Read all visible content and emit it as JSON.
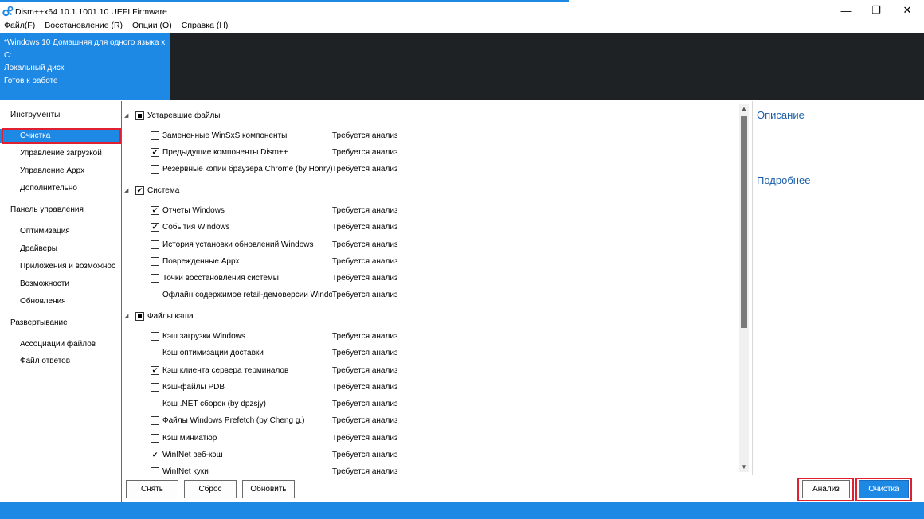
{
  "window": {
    "title": "Dism++x64 10.1.1001.10 UEFI Firmware",
    "minimize": "—",
    "maximize": "❐",
    "close": "✕"
  },
  "menu": [
    "Файл(F)",
    "Восстановление (R)",
    "Опции (O)",
    "Справка (H)"
  ],
  "session": {
    "os": "*Windows 10 Домашняя для одного языка x",
    "drive": "C:",
    "disk": "Локальный диск",
    "status": "Готов к работе"
  },
  "sidebar": {
    "groups": [
      {
        "label": "Инструменты",
        "items": [
          "Очистка",
          "Управление загрузкой",
          "Управление Appx",
          "Дополнительно"
        ]
      },
      {
        "label": "Панель управления",
        "items": [
          "Оптимизация",
          "Драйверы",
          "Приложения и возможнос",
          "Возможности",
          "Обновления"
        ]
      },
      {
        "label": "Развертывание",
        "items": [
          "Ассоциации файлов",
          "Файл ответов"
        ]
      }
    ]
  },
  "cleanup": {
    "categories": [
      {
        "label": "Устаревшие файлы",
        "state": "partial",
        "items": [
          {
            "label": "Замененные WinSxS компоненты",
            "checked": false,
            "status": "Требуется анализ"
          },
          {
            "label": "Предыдущие компоненты Dism++",
            "checked": true,
            "status": "Требуется анализ"
          },
          {
            "label": "Резервные копии браузера Chrome (by Honry)",
            "checked": false,
            "status": "Требуется анализ"
          }
        ]
      },
      {
        "label": "Система",
        "state": "checked",
        "items": [
          {
            "label": "Отчеты Windows",
            "checked": true,
            "status": "Требуется анализ"
          },
          {
            "label": "События Windows",
            "checked": true,
            "status": "Требуется анализ"
          },
          {
            "label": "История установки обновлений Windows",
            "checked": false,
            "status": "Требуется анализ"
          },
          {
            "label": "Поврежденные Appx",
            "checked": false,
            "status": "Требуется анализ"
          },
          {
            "label": "Точки восстановления системы",
            "checked": false,
            "status": "Требуется анализ"
          },
          {
            "label": "Офлайн содержимое retail-демоверсии Windows",
            "checked": false,
            "status": "Требуется анализ"
          }
        ]
      },
      {
        "label": "Файлы кэша",
        "state": "partial",
        "items": [
          {
            "label": "Кэш загрузки Windows",
            "checked": false,
            "status": "Требуется анализ"
          },
          {
            "label": "Кэш оптимизации доставки",
            "checked": false,
            "status": "Требуется анализ"
          },
          {
            "label": "Кэш клиента сервера терминалов",
            "checked": true,
            "status": "Требуется анализ"
          },
          {
            "label": "Кэш-файлы PDB",
            "checked": false,
            "status": "Требуется анализ"
          },
          {
            "label": "Кэш .NET сборок (by dpzsjy)",
            "checked": false,
            "status": "Требуется анализ"
          },
          {
            "label": "Файлы Windows Prefetch (by Cheng g.)",
            "checked": false,
            "status": "Требуется анализ"
          },
          {
            "label": "Кэш миниатюр",
            "checked": false,
            "status": "Требуется анализ"
          },
          {
            "label": "WinINet веб-кэш",
            "checked": true,
            "status": "Требуется анализ"
          },
          {
            "label": "WinINet куки",
            "checked": false,
            "status": "Требуется анализ"
          }
        ]
      }
    ]
  },
  "description": {
    "title": "Описание",
    "details": "Подробнее"
  },
  "buttons": {
    "uncheck": "Снять",
    "reset": "Сброс",
    "refresh": "Обновить",
    "analyze": "Анализ",
    "clean": "Очистка"
  },
  "colors": {
    "accent": "#1e88e5",
    "highlight": "#e02030",
    "dark_panel": "#1f2225"
  }
}
